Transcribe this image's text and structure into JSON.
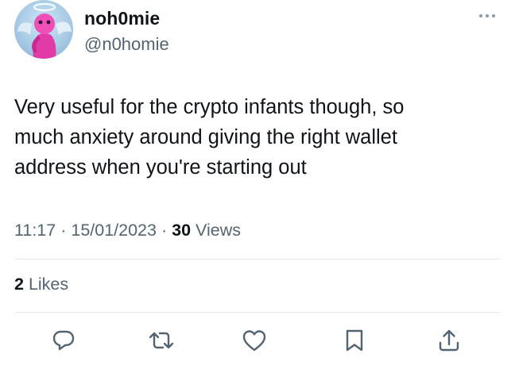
{
  "author": {
    "display_name": "noh0mie",
    "handle": "@n0homie",
    "avatar_icon": "avatar-pink-character-with-halo-and-wings"
  },
  "tweet": {
    "text": "Very useful for the crypto infants though, so\nmuch anxiety around giving the right wallet\naddress when you're starting out",
    "time": "11:17",
    "date": "15/01/2023",
    "separator": "·",
    "views_count": "30",
    "views_label": "Views"
  },
  "engagement": {
    "likes_count": "2",
    "likes_label": "Likes"
  },
  "actions": [
    {
      "name": "reply",
      "icon": "comment-bubble-icon"
    },
    {
      "name": "retweet",
      "icon": "retweet-icon"
    },
    {
      "name": "like",
      "icon": "heart-icon"
    },
    {
      "name": "bookmark",
      "icon": "bookmark-icon"
    },
    {
      "name": "share",
      "icon": "share-icon"
    }
  ],
  "colors": {
    "primary_text": "#0f1419",
    "secondary_text": "#536471",
    "divider": "#e6e9ec",
    "icon": "#536471"
  }
}
